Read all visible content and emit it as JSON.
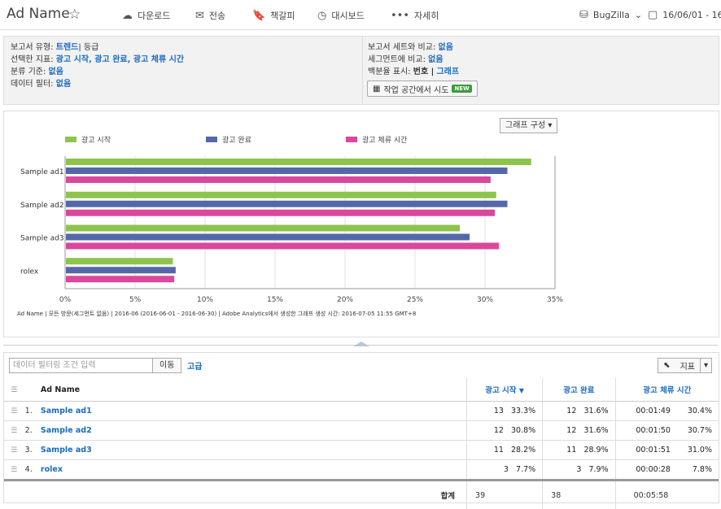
{
  "header": {
    "title": "Ad Name",
    "actions": [
      {
        "label": "다운로드",
        "icon": "cloud-download-icon",
        "glyph": "☁"
      },
      {
        "label": "전송",
        "icon": "mail-icon",
        "glyph": "✉"
      },
      {
        "label": "책갈피",
        "icon": "bookmark-icon",
        "glyph": "🔖"
      },
      {
        "label": "대시보드",
        "icon": "dashboard-icon",
        "glyph": "◷"
      },
      {
        "label": "자세히",
        "icon": "more-icon",
        "glyph": "•••"
      }
    ],
    "suite": "BugZilla",
    "date": "16/06/01 - 16/06/"
  },
  "info": {
    "left": [
      {
        "label": "보고서 유형:",
        "value": "트렌드",
        "extra": "| 등급"
      },
      {
        "label": "선택한 지표:",
        "value": "광고 시작, 광고 완료, 광고 체류 시간",
        "extra": ""
      },
      {
        "label": "분류 기준:",
        "value": "없음",
        "extra": ""
      },
      {
        "label": "데이터 필터:",
        "value": "없음",
        "extra": ""
      }
    ],
    "right": [
      {
        "label": "보고서 세트와 비교:",
        "value": "없음",
        "extra": ""
      },
      {
        "label": "세그먼트에 비교:",
        "value": "없음",
        "extra": ""
      },
      {
        "label": "백분율 표시:",
        "value": "그래프",
        "extra": "번호 |"
      }
    ],
    "try_label": "작업 공간에서 시도",
    "new_badge": "NEW"
  },
  "chart_config_label": "그래프 구성 ▾",
  "chart_data": {
    "type": "bar",
    "orientation": "horizontal",
    "categories": [
      "Sample ad1",
      "Sample ad2",
      "Sample ad3",
      "rolex"
    ],
    "series": [
      {
        "name": "광고 시작",
        "color": "#8dc44b",
        "values": [
          33.3,
          30.8,
          28.2,
          7.7
        ]
      },
      {
        "name": "광고 완료",
        "color": "#5468a8",
        "values": [
          31.6,
          31.6,
          28.9,
          7.9
        ]
      },
      {
        "name": "광고 체류 시간",
        "color": "#d9489d",
        "values": [
          30.4,
          30.7,
          31.0,
          7.8
        ]
      }
    ],
    "xlim": [
      0,
      35
    ],
    "xticks": [
      "0%",
      "5%",
      "10%",
      "15%",
      "20%",
      "25%",
      "30%",
      "35%"
    ],
    "grid": true,
    "legend": "top",
    "footnote": "Ad Name  | 모든 방문(세그먼트 없음) | 2016-06 (2016-06-01 - 2016-06-30) | Adobe Analytics에서 생성한 그래프 생성 시간: 2016-07-05 11:55 GMT+8"
  },
  "table": {
    "filter_placeholder": "데이터 필터링 조건 입력",
    "go_label": "이동",
    "advanced_label": "고급",
    "metrics_label": "지표",
    "col_name": "Ad Name",
    "col_m1": "광고 시작",
    "col_m2": "광고 완료",
    "col_m3": "광고 체류 시간",
    "rows": [
      {
        "idx": "1.",
        "name": "Sample ad1",
        "m1": "13",
        "p1": "33.3%",
        "m2": "12",
        "p2": "31.6%",
        "m3": "00:01:49",
        "p3": "30.4%"
      },
      {
        "idx": "2.",
        "name": "Sample ad2",
        "m1": "12",
        "p1": "30.8%",
        "m2": "12",
        "p2": "31.6%",
        "m3": "00:01:50",
        "p3": "30.7%"
      },
      {
        "idx": "3.",
        "name": "Sample ad3",
        "m1": "11",
        "p1": "28.2%",
        "m2": "11",
        "p2": "28.9%",
        "m3": "00:01:51",
        "p3": "31.0%"
      },
      {
        "idx": "4.",
        "name": "rolex",
        "m1": "3",
        "p1": "7.7%",
        "m2": "3",
        "p2": "7.9%",
        "m3": "00:00:28",
        "p3": "7.8%"
      }
    ],
    "total_label": "합계",
    "total_m1": "39",
    "total_m2": "38",
    "total_m3": "00:05:58"
  }
}
